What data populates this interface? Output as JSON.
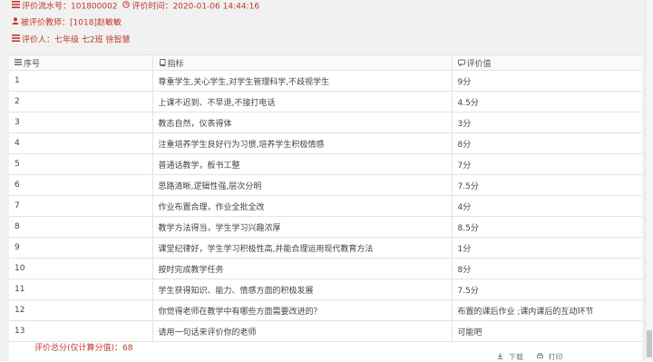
{
  "header": {
    "serial_label": "评价流水号：",
    "serial_value": "101800002",
    "time_label": "评价时间：",
    "time_value": "2020-01-06 14:44:16",
    "teacher_label": "被评价教师：",
    "teacher_value": "[1018]赵敏敏",
    "evaluator_label": "评价人：",
    "evaluator_value": "七年级 七2班 徐智慧"
  },
  "table": {
    "columns": [
      "序号",
      "指标",
      "评价值"
    ],
    "rows": [
      [
        "1",
        "尊重学生,关心学生,对学生管理科学,不歧视学生",
        "9分"
      ],
      [
        "2",
        "上课不迟到、不早退,不接打电话",
        "4.5分"
      ],
      [
        "3",
        "教态自然，仪表得体",
        "3分"
      ],
      [
        "4",
        "注重培养学生良好行为习惯,培养学生积极情感",
        "8分"
      ],
      [
        "5",
        "普通话教学，板书工整",
        "7分"
      ],
      [
        "6",
        "思路清晰,逻辑性强,层次分明",
        "7.5分"
      ],
      [
        "7",
        "作业布置合理，作业全批全改",
        "4分"
      ],
      [
        "8",
        "教学方法得当，学生学习兴趣浓厚",
        "8.5分"
      ],
      [
        "9",
        "课堂纪律好，学生学习积极性高,并能合理运用现代教育方法",
        "1分"
      ],
      [
        "10",
        "按时完成教学任务",
        "8分"
      ],
      [
        "11",
        "学生获得知识、能力、情感方面的积极发展",
        "7.5分"
      ],
      [
        "12",
        "你觉得老师在教学中有哪些方面需要改进的？",
        "布置的课后作业 ;课内课后的互动环节"
      ],
      [
        "13",
        "请用一句话来评价你的老师",
        "可能吧"
      ]
    ]
  },
  "total": {
    "label": "评价总分(仅计算分值)：",
    "value": "68"
  },
  "bottom_bar": {
    "items": [
      "下载",
      "打印"
    ]
  },
  "colors": {
    "accent": "#c0392b",
    "background": "#f1f1f1"
  },
  "icons": [
    "list-icon",
    "clock-icon",
    "user-icon",
    "list-icon",
    "book-icon",
    "comment-icon"
  ]
}
